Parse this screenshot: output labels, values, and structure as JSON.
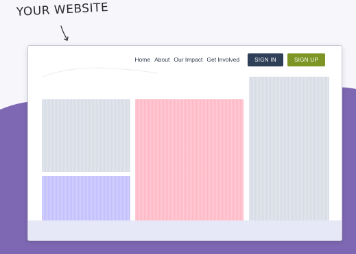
{
  "caption": {
    "text": "YOUR WEBSITE"
  },
  "nav": {
    "links": [
      {
        "label": "Home"
      },
      {
        "label": "About"
      },
      {
        "label": "Our Impact"
      },
      {
        "label": "Get Involved"
      }
    ],
    "sign_in_label": "SIGN IN",
    "sign_up_label": "SIGN UP"
  },
  "colors": {
    "purple_background": "#7f68b3",
    "sign_in_button": "#2e3f57",
    "sign_up_button": "#7d9524",
    "placeholder_gray": "#d7dce6",
    "placeholder_lavender": "#c2bffd",
    "placeholder_pink": "#ffb9c6"
  },
  "icons": {
    "caption_arrow": "hand-drawn-arrow-icon"
  }
}
